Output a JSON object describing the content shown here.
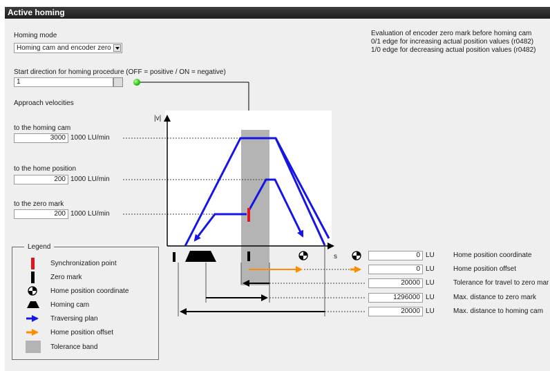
{
  "window": {
    "title": "Active homing"
  },
  "homing_mode": {
    "label": "Homing mode",
    "value": "Homing cam and encoder zero"
  },
  "evaluation_note": {
    "line1": "Evaluation of encoder zero mark before homing cam",
    "line2": "0/1 edge for increasing actual position values (r0482)",
    "line3": "1/0 edge for decreasing actual position values (r0482)"
  },
  "start_direction": {
    "label": "Start direction for homing procedure (OFF = positive / ON = negative)",
    "value": "1"
  },
  "approach": {
    "heading": "Approach velocities",
    "homing_cam": {
      "label": "to the homing cam",
      "value": "3000",
      "unit": "1000 LU/min"
    },
    "home_position": {
      "label": "to the home position",
      "value": "200",
      "unit": "1000 LU/min"
    },
    "zero_mark": {
      "label": "to the zero mark",
      "value": "200",
      "unit": "1000 LU/min"
    }
  },
  "diagram": {
    "y_axis_label": "|v|",
    "x_axis_label": "s"
  },
  "params": {
    "home_position_coordinate": {
      "label": "Home position coordinate",
      "value": "0",
      "unit": "LU"
    },
    "home_position_offset": {
      "label": "Home position offset",
      "value": "0",
      "unit": "LU"
    },
    "tolerance_zero_mark": {
      "label": "Tolerance for travel to zero mark",
      "value": "20000",
      "unit": "LU"
    },
    "max_distance_zero_mark": {
      "label": "Max. distance to zero mark",
      "value": "1296000",
      "unit": "LU"
    },
    "max_distance_homing_cam": {
      "label": "Max. distance to homing cam",
      "value": "20000",
      "unit": "LU"
    }
  },
  "legend": {
    "title": "Legend",
    "items": [
      {
        "label": "Synchronization point",
        "icon": "red-bar-icon"
      },
      {
        "label": "Zero mark",
        "icon": "black-bar-icon"
      },
      {
        "label": "Home position coordinate",
        "icon": "crosshair-circle-icon"
      },
      {
        "label": "Homing cam",
        "icon": "trapezoid-icon"
      },
      {
        "label": "Traversing plan",
        "icon": "blue-arrow-icon"
      },
      {
        "label": "Home position offset",
        "icon": "orange-arrow-icon"
      },
      {
        "label": "Tolerance band",
        "icon": "gray-box-icon"
      }
    ]
  },
  "colors": {
    "traversing": "#1515e6",
    "offset": "#ff8c00",
    "sync": "#e0141e",
    "tolerance": "#b4b4b4",
    "titlebar": "#2b2b2b"
  }
}
